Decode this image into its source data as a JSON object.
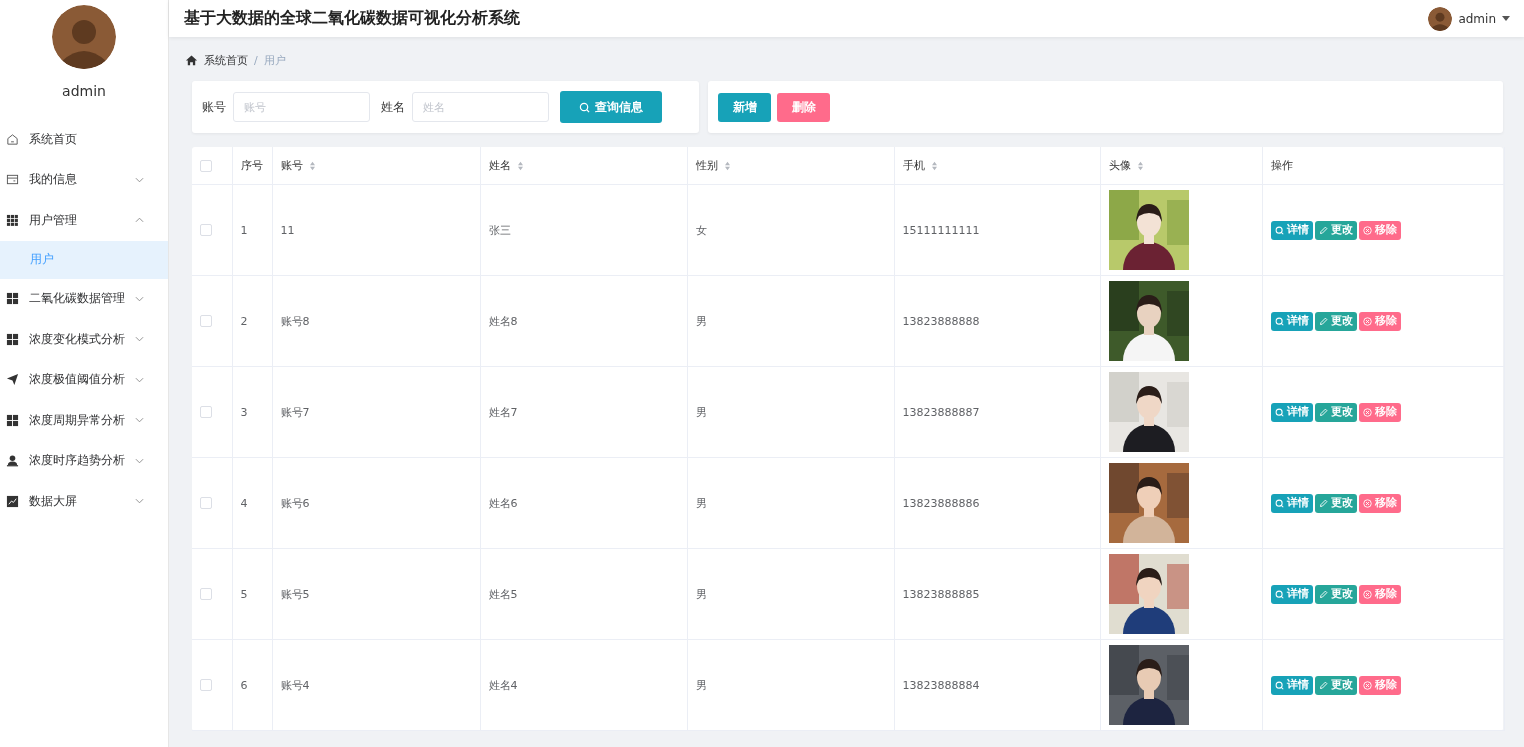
{
  "sidebar": {
    "user": {
      "name": "admin"
    },
    "items": [
      {
        "label": "系统首页"
      },
      {
        "label": "我的信息",
        "expandable": true,
        "expanded": false
      },
      {
        "label": "用户管理",
        "expandable": true,
        "expanded": true,
        "children": [
          {
            "label": "用户",
            "selected": true
          }
        ]
      },
      {
        "label": "二氧化碳数据管理",
        "expandable": true,
        "expanded": false
      },
      {
        "label": "浓度变化模式分析",
        "expandable": true,
        "expanded": false
      },
      {
        "label": "浓度极值阈值分析",
        "expandable": true,
        "expanded": false
      },
      {
        "label": "浓度周期异常分析",
        "expandable": true,
        "expanded": false
      },
      {
        "label": "浓度时序趋势分析",
        "expandable": true,
        "expanded": false
      },
      {
        "label": "数据大屏",
        "expandable": true,
        "expanded": false
      }
    ]
  },
  "header": {
    "title": "基于大数据的全球二氧化碳数据可视化分析系统",
    "user": "admin"
  },
  "breadcrumb": {
    "items": [
      "系统首页",
      "用户"
    ],
    "separator": "/"
  },
  "search": {
    "fields": [
      {
        "label": "账号",
        "placeholder": "账号"
      },
      {
        "label": "姓名",
        "placeholder": "姓名"
      }
    ],
    "button": "查询信息"
  },
  "actions": [
    {
      "label": "新增",
      "kind": "primary"
    },
    {
      "label": "删除",
      "kind": "danger"
    }
  ],
  "table": {
    "header_checked": false,
    "columns": [
      {
        "label": "序号",
        "kind": "plain"
      },
      {
        "label": "账号",
        "kind": "sortable"
      },
      {
        "label": "姓名",
        "kind": "sortable"
      },
      {
        "label": "性别",
        "kind": "sortable"
      },
      {
        "label": "手机",
        "kind": "sortable"
      },
      {
        "label": "头像",
        "kind": "sortable"
      },
      {
        "label": "操作",
        "kind": "plain"
      }
    ],
    "rows": [
      {
        "checked": false,
        "index": "1",
        "account": "11",
        "name": "张三",
        "gender": "女",
        "phone": "15111111111",
        "actions": [
          {
            "label": "详情",
            "kind": "view"
          },
          {
            "label": "更改",
            "kind": "edit"
          },
          {
            "label": "移除",
            "kind": "remove"
          }
        ]
      },
      {
        "checked": false,
        "index": "2",
        "account": "账号8",
        "name": "姓名8",
        "gender": "男",
        "phone": "13823888888",
        "actions": [
          {
            "label": "详情",
            "kind": "view"
          },
          {
            "label": "更改",
            "kind": "edit"
          },
          {
            "label": "移除",
            "kind": "remove"
          }
        ]
      },
      {
        "checked": false,
        "index": "3",
        "account": "账号7",
        "name": "姓名7",
        "gender": "男",
        "phone": "13823888887",
        "actions": [
          {
            "label": "详情",
            "kind": "view"
          },
          {
            "label": "更改",
            "kind": "edit"
          },
          {
            "label": "移除",
            "kind": "remove"
          }
        ]
      },
      {
        "checked": false,
        "index": "4",
        "account": "账号6",
        "name": "姓名6",
        "gender": "男",
        "phone": "13823888886",
        "actions": [
          {
            "label": "详情",
            "kind": "view"
          },
          {
            "label": "更改",
            "kind": "edit"
          },
          {
            "label": "移除",
            "kind": "remove"
          }
        ]
      },
      {
        "checked": false,
        "index": "5",
        "account": "账号5",
        "name": "姓名5",
        "gender": "男",
        "phone": "13823888885",
        "actions": [
          {
            "label": "详情",
            "kind": "view"
          },
          {
            "label": "更改",
            "kind": "edit"
          },
          {
            "label": "移除",
            "kind": "remove"
          }
        ]
      },
      {
        "checked": false,
        "index": "6",
        "account": "账号4",
        "name": "姓名4",
        "gender": "男",
        "phone": "13823888884",
        "actions": [
          {
            "label": "详情",
            "kind": "view"
          },
          {
            "label": "更改",
            "kind": "edit"
          },
          {
            "label": "移除",
            "kind": "remove"
          }
        ]
      }
    ]
  }
}
